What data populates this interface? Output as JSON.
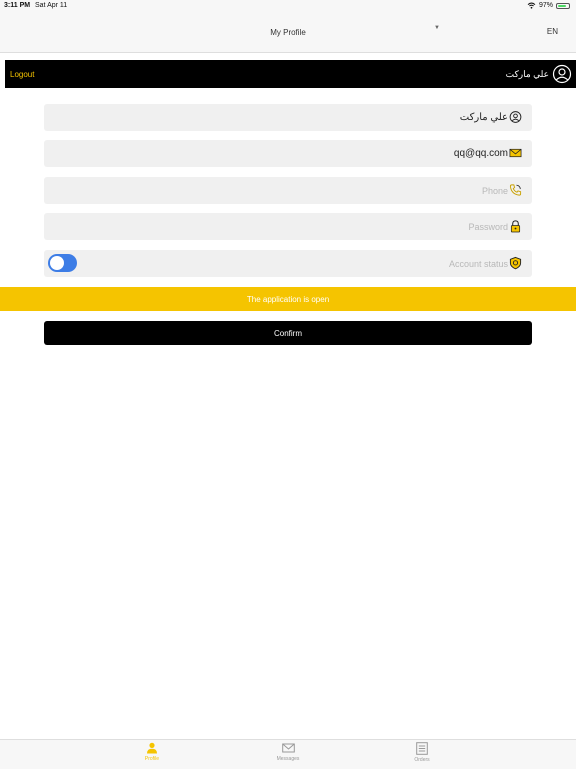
{
  "status_bar": {
    "time": "3:11 PM",
    "date": "Sat Apr 11",
    "battery": "97%"
  },
  "nav": {
    "title": "My Profile",
    "language": "EN"
  },
  "user_bar": {
    "logout_label": "Logout",
    "user_name": "علي ماركت"
  },
  "form": {
    "name_value": "علي ماركت",
    "email_value": "qq@qq.com",
    "phone_placeholder": "Phone",
    "password_placeholder": "Password",
    "account_status_label": "Account status",
    "account_status_on": true
  },
  "banner": {
    "text": "The application is open"
  },
  "confirm_label": "Confirm",
  "tabs": [
    {
      "label": "Profile",
      "icon": "person-icon",
      "active": true
    },
    {
      "label": "Messages",
      "icon": "envelope-icon",
      "active": false
    },
    {
      "label": "Orders",
      "icon": "list-icon",
      "active": false
    }
  ],
  "colors": {
    "accent": "#f5c400",
    "toggle": "#3d7de6",
    "bar": "#000000"
  }
}
